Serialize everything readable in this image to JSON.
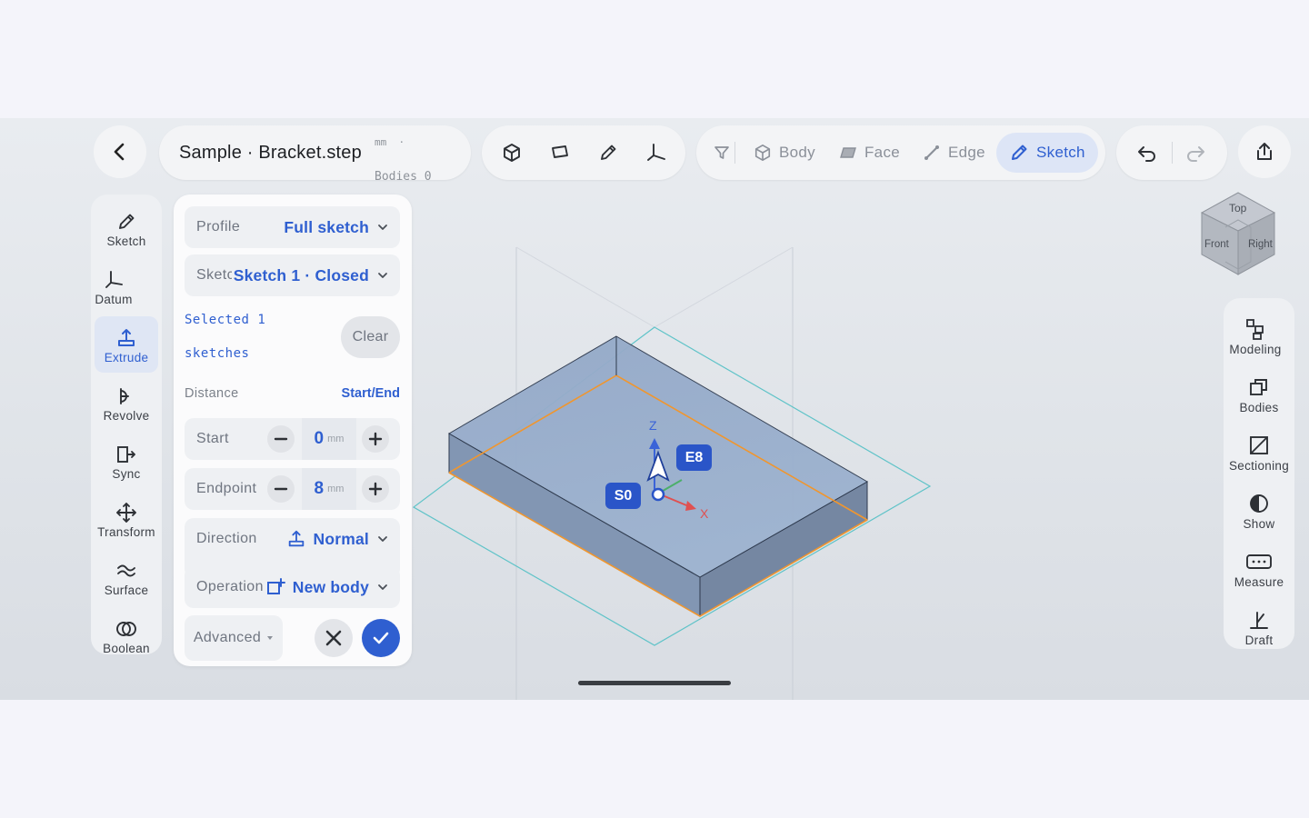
{
  "header": {
    "file_name": "Sample · Bracket.step",
    "units_meta": "mm  ·",
    "bodies_meta": "Bodies 0"
  },
  "filter_bar": {
    "items": [
      {
        "label": "Body",
        "icon": "cube-icon"
      },
      {
        "label": "Face",
        "icon": "face-icon"
      },
      {
        "label": "Edge",
        "icon": "edge-icon"
      },
      {
        "label": "Sketch",
        "icon": "pencil-icon",
        "active": true
      }
    ]
  },
  "left_tools": [
    {
      "label": "Sketch",
      "icon": "pencil-icon"
    },
    {
      "label": "Datum",
      "icon": "datum-axes-icon"
    },
    {
      "label": "Extrude",
      "icon": "extrude-icon",
      "active": true
    },
    {
      "label": "Revolve",
      "icon": "revolve-icon"
    },
    {
      "label": "Sync",
      "icon": "sync-icon"
    },
    {
      "label": "Transform",
      "icon": "move-arrows-icon"
    },
    {
      "label": "Surface",
      "icon": "surface-icon"
    },
    {
      "label": "Boolean",
      "icon": "boolean-icon"
    }
  ],
  "panel": {
    "profile": {
      "label": "Profile",
      "value": "Full sketch"
    },
    "sketch": {
      "label": "Sketch",
      "value": "Sketch 1 · Closed"
    },
    "selected_line1": "Selected 1",
    "selected_line2": "sketches",
    "clear_label": "Clear",
    "distance_label": "Distance",
    "distance_mode": "Start/End",
    "start": {
      "label": "Start",
      "value": "0",
      "unit": "mm"
    },
    "endpoint": {
      "label": "Endpoint",
      "value": "8",
      "unit": "mm"
    },
    "direction": {
      "label": "Direction",
      "value": "Normal"
    },
    "operation": {
      "label": "Operation",
      "value": "New body"
    },
    "advanced_label": "Advanced"
  },
  "viewport": {
    "tags": {
      "start": "S0",
      "end": "E8"
    },
    "axes": {
      "z": "Z",
      "x": "X"
    },
    "view_cube": {
      "top": "Top",
      "front": "Front",
      "right": "Right"
    }
  },
  "right_tools": [
    {
      "label": "Modeling",
      "icon": "modeling-icon"
    },
    {
      "label": "Bodies",
      "icon": "bodies-icon"
    },
    {
      "label": "Sectioning",
      "icon": "sectioning-icon"
    },
    {
      "label": "Show",
      "icon": "show-icon"
    },
    {
      "label": "Measure",
      "icon": "measure-icon"
    },
    {
      "label": "Draft",
      "icon": "draft-icon"
    }
  ],
  "colors": {
    "accent": "#2f5fd0",
    "body_fill": "#8fa6c6",
    "edge_orange": "#f0962e",
    "plane_teal": "#5fc3c8"
  }
}
